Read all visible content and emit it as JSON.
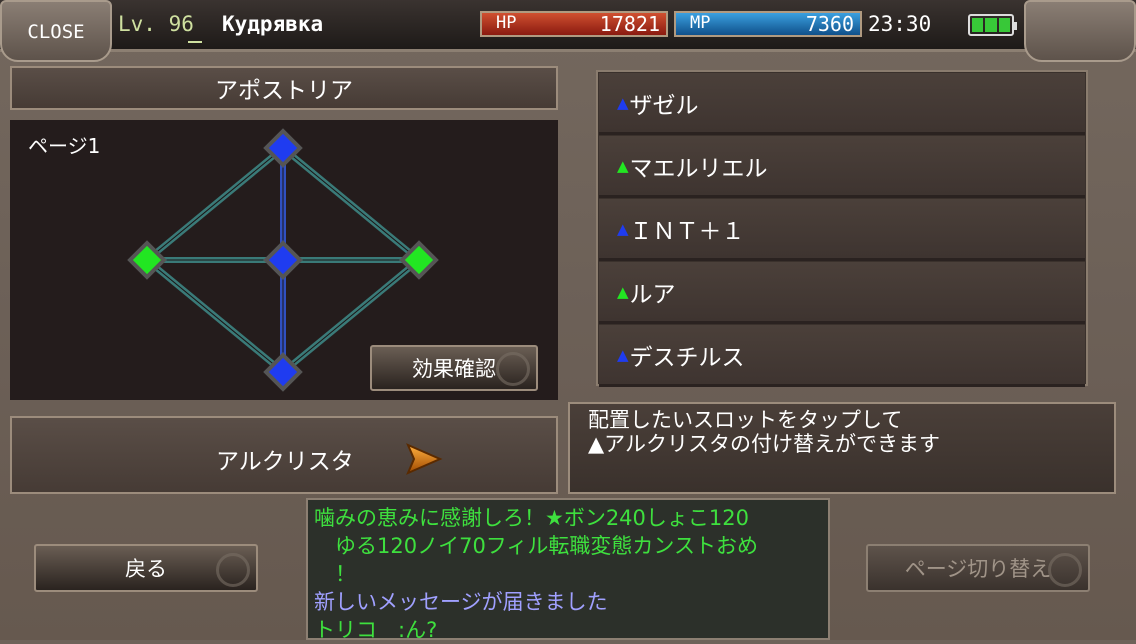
{
  "header": {
    "close_label": "CLOSE",
    "level": "Lv. 96",
    "player_name": "Кудрявка",
    "hp_label": "HP",
    "hp_value": "17821",
    "mp_label": "MP",
    "mp_value": "7360",
    "clock": "23:30",
    "battery_icon": "battery-icon"
  },
  "board": {
    "title": "アポストリア",
    "page_label": "ページ1",
    "effect_button": "効果確認",
    "nodes": [
      {
        "id": "top",
        "color": "#1f3cf0"
      },
      {
        "id": "left",
        "color": "#22e622"
      },
      {
        "id": "center",
        "color": "#1f3cf0"
      },
      {
        "id": "right",
        "color": "#22e622"
      },
      {
        "id": "bottom",
        "color": "#1f3cf0"
      }
    ]
  },
  "slots": [
    {
      "marker": "▲",
      "marker_color": "#1f3cf0",
      "name": "ザゼル"
    },
    {
      "marker": "▲",
      "marker_color": "#22e622",
      "name": "マエルリエル"
    },
    {
      "marker": "▲",
      "marker_color": "#1f3cf0",
      "name": "ＩＮＴ＋１"
    },
    {
      "marker": "▲",
      "marker_color": "#22e622",
      "name": "ルア"
    },
    {
      "marker": "▲",
      "marker_color": "#1f3cf0",
      "name": "デスチルス"
    }
  ],
  "crysta": {
    "label": "アルクリスタ",
    "arrow_icon": "play-arrow-icon"
  },
  "info": {
    "line1": "配置したいスロットをタップして",
    "line2": "▲アルクリスタの付け替えができます"
  },
  "buttons": {
    "back": "戻る",
    "page_switch": "ページ切り替え"
  },
  "chat": [
    {
      "text": "噛みの恵みに感謝しろ！★ボン240しょこ120",
      "color": "g"
    },
    {
      "text": "　ゆる120ノイ70フィル転職変態カンストおめ",
      "color": "g"
    },
    {
      "text": "　！",
      "color": "g"
    },
    {
      "text": "新しいメッセージが届きました",
      "color": "b"
    },
    {
      "text": "トリコ　:ん?",
      "color": "g"
    }
  ]
}
